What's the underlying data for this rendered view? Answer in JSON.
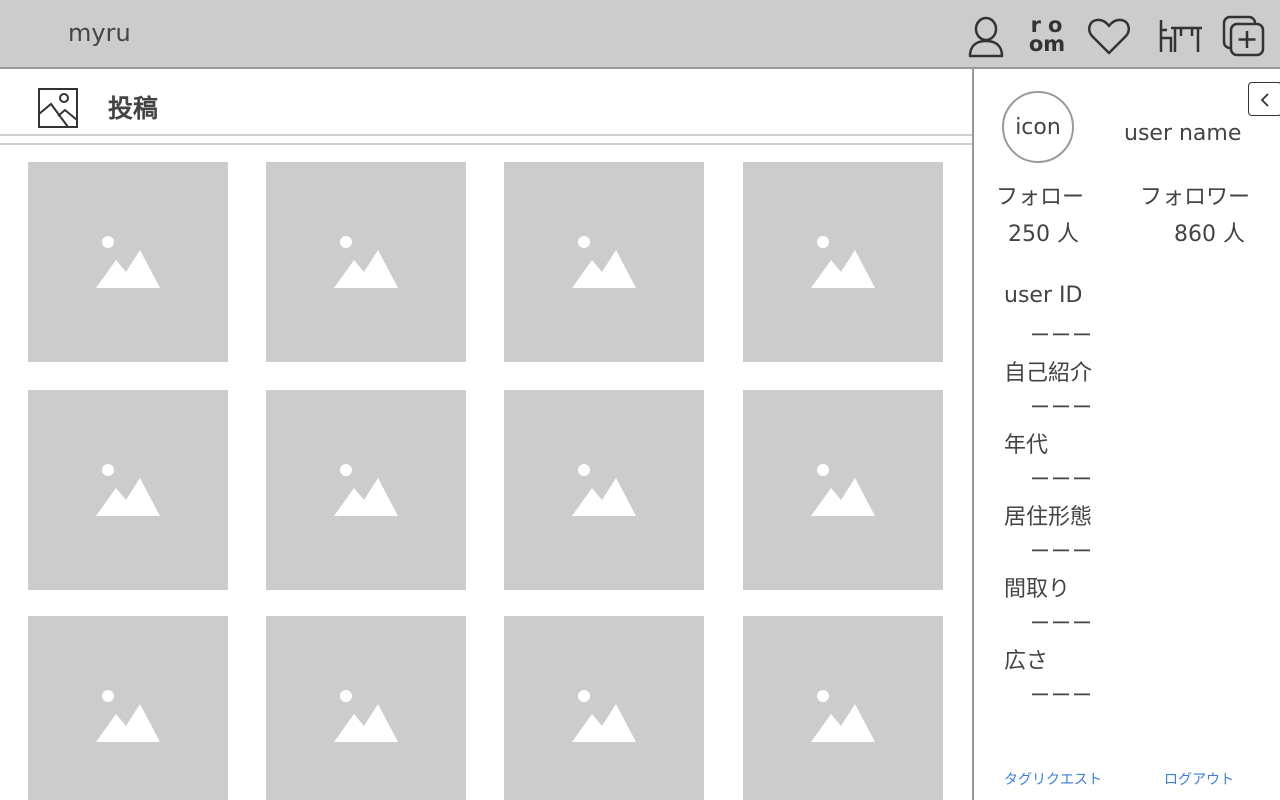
{
  "header": {
    "brand": "myru",
    "icons": {
      "user": "user-icon",
      "room_line1": "ro",
      "room_line2": "om",
      "heart": "heart-icon",
      "furniture": "furniture-icon",
      "add": "add-post-icon"
    }
  },
  "posts": {
    "title": "投稿",
    "tiles": [
      "image-placeholder",
      "image-placeholder",
      "image-placeholder",
      "image-placeholder",
      "image-placeholder",
      "image-placeholder",
      "image-placeholder",
      "image-placeholder",
      "image-placeholder",
      "image-placeholder",
      "image-placeholder",
      "image-placeholder"
    ]
  },
  "sidebar": {
    "avatar_text": "icon",
    "username": "user name",
    "follow_label": "フォロー",
    "follow_count": "250 人",
    "follower_label": "フォロワー",
    "follower_count": "860 人",
    "fields": [
      {
        "label": "user ID",
        "value": "ーーー"
      },
      {
        "label": "自己紹介",
        "value": "ーーー"
      },
      {
        "label": "年代",
        "value": "ーーー"
      },
      {
        "label": "居住形態",
        "value": "ーーー"
      },
      {
        "label": "間取り",
        "value": "ーーー"
      },
      {
        "label": "広さ",
        "value": "ーーー"
      }
    ],
    "tag_request": "タグリクエスト",
    "logout": "ログアウト"
  },
  "colors": {
    "header_bg": "#cccccc",
    "tile_bg": "#cccccc",
    "link": "#3b7fd9"
  }
}
